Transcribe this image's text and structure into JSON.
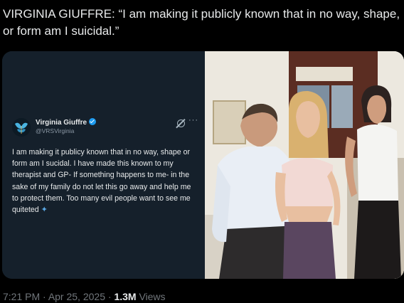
{
  "post": {
    "text": "VIRGINIA GIUFFRE: “I am making it publicly known that in no way, shape, or form am I suicidal.”"
  },
  "embed": {
    "name": "Virginia Giuffre",
    "handle": "@VRSVirginia",
    "body": "I am making it publicy known that in no way, shape or form am I sucidal. I have made this known to my therapist and GP- If something happens to me- in the sake of my family do not let this go away and help me to protect them. Too many evil people want to see me quiteted",
    "more": "···",
    "icons": [
      "verified-icon",
      "grok-icon",
      "more-icon",
      "butterfly-icon"
    ]
  },
  "meta": {
    "time": "7:21 PM",
    "sep1": " · ",
    "date": "Apr 25, 2025",
    "sep2": " · ",
    "views_count": "1.3M",
    "views_label": " Views"
  },
  "colors": {
    "background": "#000000",
    "card": "#15202b",
    "accent": "#1d9bf0",
    "muted": "#71767b"
  }
}
